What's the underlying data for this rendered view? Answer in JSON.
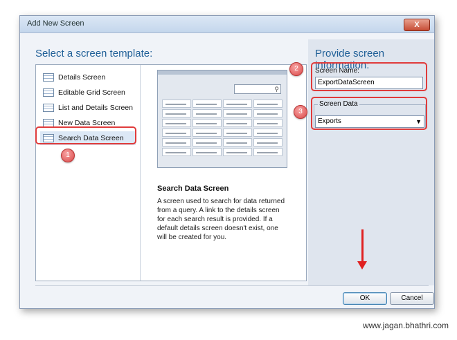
{
  "window": {
    "title": "Add New Screen",
    "close_label": "X"
  },
  "left": {
    "heading": "Select a screen template:",
    "templates": [
      {
        "label": "Details Screen",
        "selected": false
      },
      {
        "label": "Editable Grid Screen",
        "selected": false
      },
      {
        "label": "List and Details Screen",
        "selected": false
      },
      {
        "label": "New Data Screen",
        "selected": false
      },
      {
        "label": "Search Data Screen",
        "selected": true
      }
    ]
  },
  "preview": {
    "title": "Search Data Screen",
    "description": "A screen used to search for data returned from a query.  A link to the details screen for each search result is provided.  If a default details screen doesn't exist, one will be created for you."
  },
  "right": {
    "heading": "Provide screen information:",
    "screen_name_label": "Screen Name:",
    "screen_name_value": "ExportDataScreen",
    "screen_data_label": "Screen Data",
    "screen_data_value": "Exports"
  },
  "annotations": {
    "badge1": "1",
    "badge2": "2",
    "badge3": "3"
  },
  "buttons": {
    "ok": "OK",
    "cancel": "Cancel"
  },
  "watermark": "www.jagan.bhathri.com",
  "colors": {
    "heading": "#1f5f97",
    "annotation_red": "#e03b3b"
  }
}
